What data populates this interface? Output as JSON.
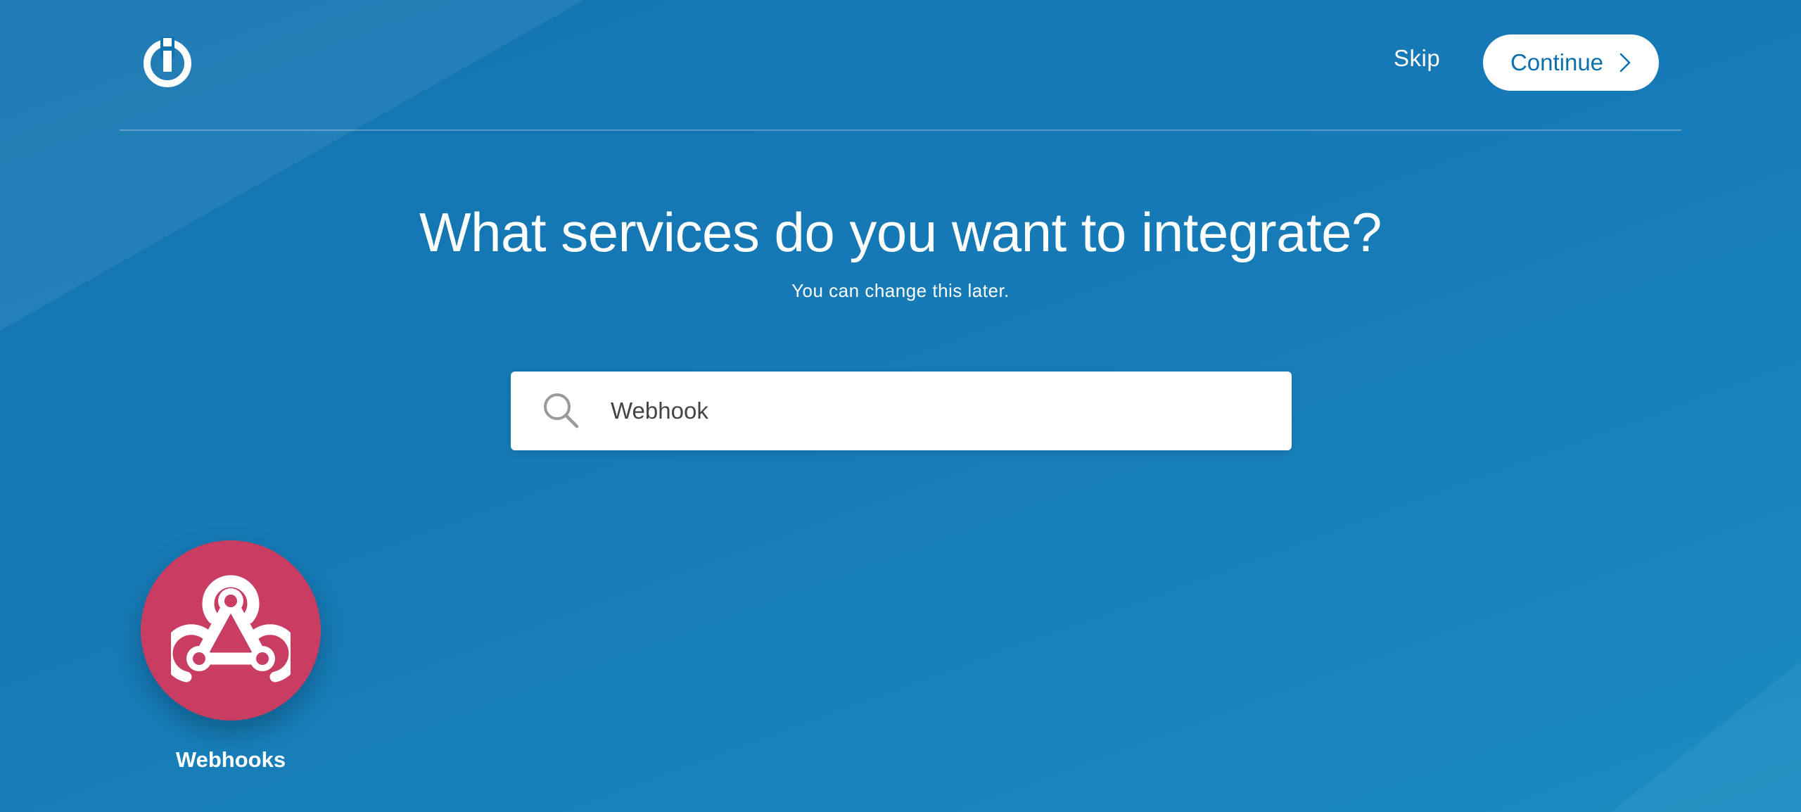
{
  "header": {
    "logo_icon": "ifttt-power-logo-icon",
    "skip_label": "Skip",
    "continue_label": "Continue",
    "continue_icon": "chevron-right-icon"
  },
  "main": {
    "title": "What services do you want to integrate?",
    "subtitle": "You can change this later."
  },
  "search": {
    "icon": "search-icon",
    "value": "Webhook"
  },
  "results": [
    {
      "label": "Webhooks",
      "icon": "webhooks-icon",
      "color": "#c93d63"
    }
  ],
  "colors": {
    "background": "#1273b0",
    "accent_text": "#0c6fae",
    "tile": "#c93d63"
  }
}
